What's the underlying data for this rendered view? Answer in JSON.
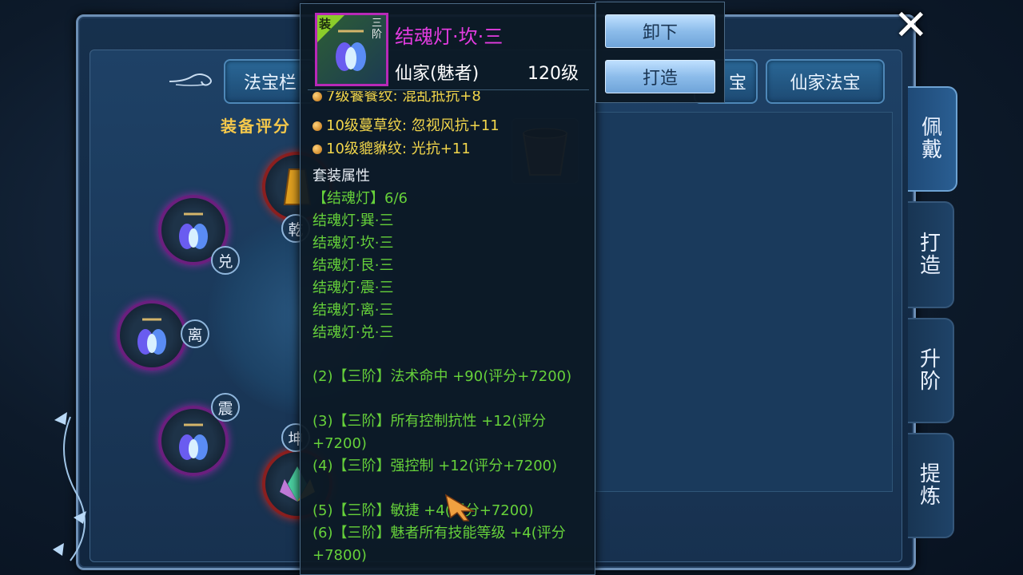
{
  "tabs": [
    {
      "label": "法宝栏"
    },
    {
      "label": "宝"
    },
    {
      "label": "仙家法宝"
    }
  ],
  "score_label": "装备评分",
  "side_tabs": [
    {
      "label": "佩\n戴",
      "active": true
    },
    {
      "label": "打\n造",
      "active": false
    },
    {
      "label": "升\n阶",
      "active": false
    },
    {
      "label": "提\n炼",
      "active": false
    }
  ],
  "slots": {
    "qian": "乾",
    "dui": "兑",
    "li": "离",
    "zhen": "震",
    "kun": "坤"
  },
  "tooltip": {
    "corner_tag": "装",
    "tier_tag": "三阶",
    "name": "结魂灯·坎·三",
    "class": "仙家(魅者)",
    "level": "120级",
    "partial_line": "7级饕餮纹: 混乱抵抗+8",
    "attributes": [
      "10级蔓草纹: 忽视风抗+11",
      "10级貔貅纹: 光抗+11"
    ],
    "set_header": "套装属性",
    "set_name": "【结魂灯】6/6",
    "set_pieces": [
      "结魂灯·巽·三",
      "结魂灯·坎·三",
      "结魂灯·艮·三",
      "结魂灯·震·三",
      "结魂灯·离·三",
      "结魂灯·兑·三"
    ],
    "set_effects": [
      "(2)【三阶】法术命中 +90(评分+7200)",
      "(3)【三阶】所有控制抗性 +12(评分+7200)",
      "(4)【三阶】强控制 +12(评分+7200)",
      "(5)【三阶】敏捷 +4(评分+7200)",
      "(6)【三阶】魅者所有技能等级 +4(评分+7800)"
    ]
  },
  "actions": {
    "unequip": "卸下",
    "forge": "打造"
  },
  "colors": {
    "item_name": "#e33ce0",
    "set_green": "#66d13a",
    "attr_yellow": "#f2d64b",
    "score_gold": "#f5c84b"
  }
}
